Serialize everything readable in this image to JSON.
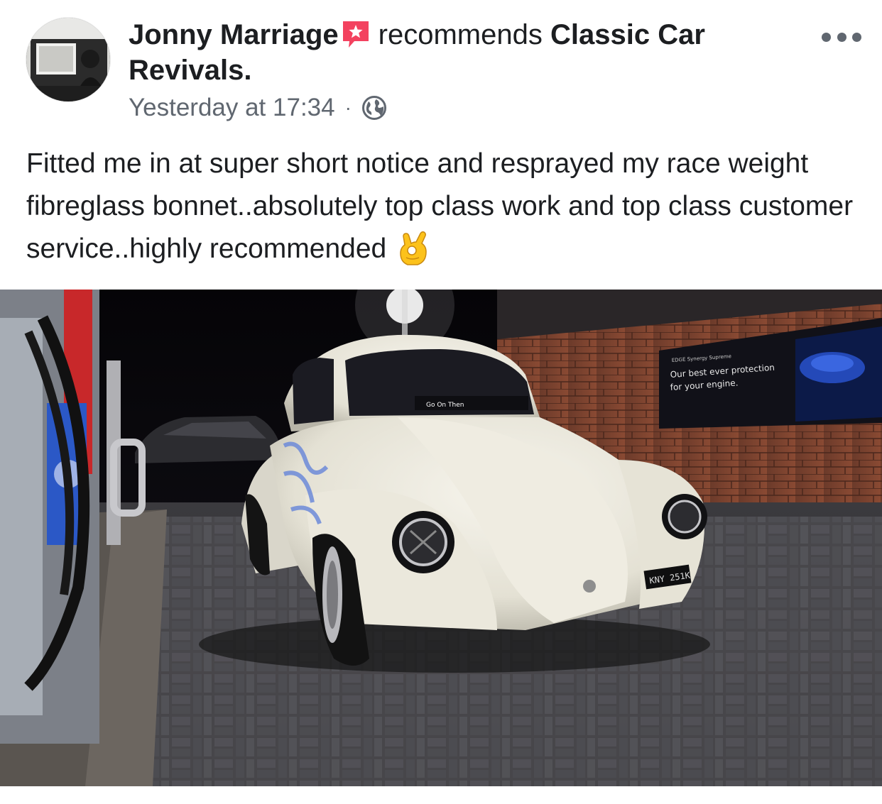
{
  "post": {
    "author": "Jonny Marriage",
    "action": "recommends",
    "page": "Classic Car Revivals.",
    "timestamp": "Yesterday at 17:34",
    "separator": "·",
    "privacy_icon": "globe-icon",
    "recommend_icon": "recommendation-star-icon",
    "more_icon": "more-options-icon",
    "text": "Fitted me in at super short notice and resprayed my race weight fibreglass bonnet..absolutely top class work and top class customer service..highly recommended",
    "emoji": "ok-hand-emoji"
  },
  "photo": {
    "windscreen_sticker": "Go On Then",
    "number_plate": "KNY 251K",
    "billboard_small_text": "EDGE Synergy Supreme",
    "billboard_text_line1": "Our best ever protection",
    "billboard_text_line2": "for your engine."
  },
  "colors": {
    "recommend_badge": "#f3425f",
    "secondary_text": "#606770",
    "primary_text": "#1c1e21",
    "car_body": "#e9e6da"
  }
}
